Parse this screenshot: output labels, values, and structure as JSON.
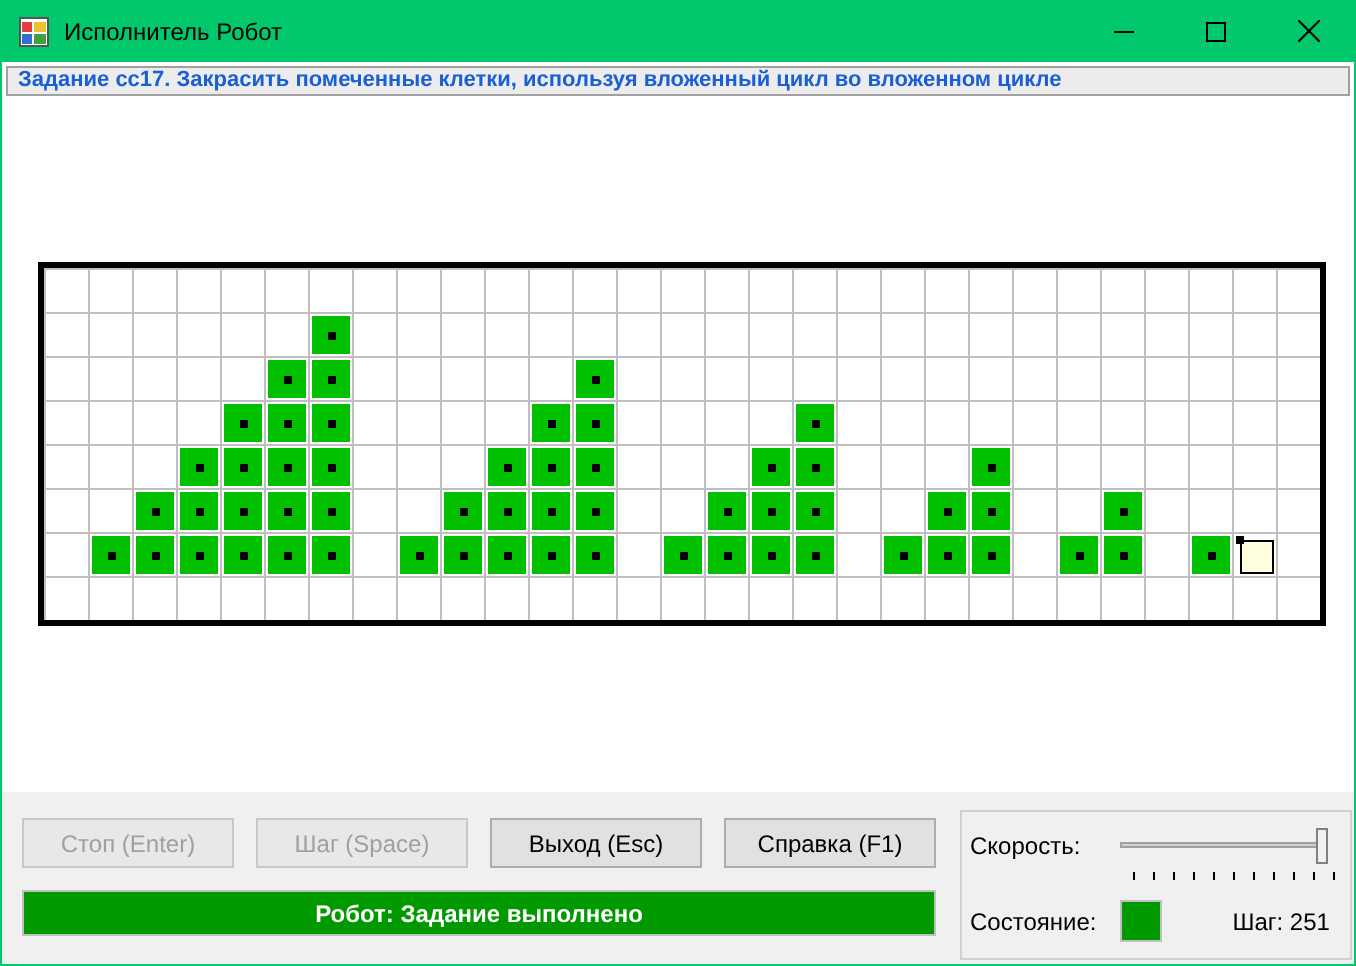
{
  "window": {
    "title": "Исполнитель Робот"
  },
  "task": {
    "text": "Задание cc17. Закрасить помеченные клетки, используя вложенный цикл во вложенном цикле"
  },
  "field": {
    "rows": [
      {
        "cells": [
          {
            "kind": "empty"
          },
          {
            "kind": "empty"
          },
          {
            "kind": "empty"
          },
          {
            "kind": "empty"
          },
          {
            "kind": "empty"
          },
          {
            "kind": "empty"
          },
          {
            "kind": "empty"
          },
          {
            "kind": "empty"
          },
          {
            "kind": "empty"
          },
          {
            "kind": "empty"
          },
          {
            "kind": "empty"
          },
          {
            "kind": "empty"
          },
          {
            "kind": "empty"
          },
          {
            "kind": "empty"
          },
          {
            "kind": "empty"
          },
          {
            "kind": "empty"
          },
          {
            "kind": "empty"
          },
          {
            "kind": "empty"
          },
          {
            "kind": "empty"
          },
          {
            "kind": "empty"
          },
          {
            "kind": "empty"
          },
          {
            "kind": "empty"
          },
          {
            "kind": "empty"
          },
          {
            "kind": "empty"
          },
          {
            "kind": "empty"
          },
          {
            "kind": "empty"
          },
          {
            "kind": "empty"
          },
          {
            "kind": "empty"
          },
          {
            "kind": "empty"
          }
        ]
      },
      {
        "cells": [
          {
            "kind": "empty"
          },
          {
            "kind": "empty"
          },
          {
            "kind": "empty"
          },
          {
            "kind": "empty"
          },
          {
            "kind": "empty"
          },
          {
            "kind": "empty"
          },
          {
            "kind": "painted"
          },
          {
            "kind": "empty"
          },
          {
            "kind": "empty"
          },
          {
            "kind": "empty"
          },
          {
            "kind": "empty"
          },
          {
            "kind": "empty"
          },
          {
            "kind": "empty"
          },
          {
            "kind": "empty"
          },
          {
            "kind": "empty"
          },
          {
            "kind": "empty"
          },
          {
            "kind": "empty"
          },
          {
            "kind": "empty"
          },
          {
            "kind": "empty"
          },
          {
            "kind": "empty"
          },
          {
            "kind": "empty"
          },
          {
            "kind": "empty"
          },
          {
            "kind": "empty"
          },
          {
            "kind": "empty"
          },
          {
            "kind": "empty"
          },
          {
            "kind": "empty"
          },
          {
            "kind": "empty"
          },
          {
            "kind": "empty"
          },
          {
            "kind": "empty"
          }
        ]
      },
      {
        "cells": [
          {
            "kind": "empty"
          },
          {
            "kind": "empty"
          },
          {
            "kind": "empty"
          },
          {
            "kind": "empty"
          },
          {
            "kind": "empty"
          },
          {
            "kind": "painted"
          },
          {
            "kind": "painted"
          },
          {
            "kind": "empty"
          },
          {
            "kind": "empty"
          },
          {
            "kind": "empty"
          },
          {
            "kind": "empty"
          },
          {
            "kind": "empty"
          },
          {
            "kind": "painted"
          },
          {
            "kind": "empty"
          },
          {
            "kind": "empty"
          },
          {
            "kind": "empty"
          },
          {
            "kind": "empty"
          },
          {
            "kind": "empty"
          },
          {
            "kind": "empty"
          },
          {
            "kind": "empty"
          },
          {
            "kind": "empty"
          },
          {
            "kind": "empty"
          },
          {
            "kind": "empty"
          },
          {
            "kind": "empty"
          },
          {
            "kind": "empty"
          },
          {
            "kind": "empty"
          },
          {
            "kind": "empty"
          },
          {
            "kind": "empty"
          },
          {
            "kind": "empty"
          }
        ]
      },
      {
        "cells": [
          {
            "kind": "empty"
          },
          {
            "kind": "empty"
          },
          {
            "kind": "empty"
          },
          {
            "kind": "empty"
          },
          {
            "kind": "painted"
          },
          {
            "kind": "painted"
          },
          {
            "kind": "painted"
          },
          {
            "kind": "empty"
          },
          {
            "kind": "empty"
          },
          {
            "kind": "empty"
          },
          {
            "kind": "empty"
          },
          {
            "kind": "painted"
          },
          {
            "kind": "painted"
          },
          {
            "kind": "empty"
          },
          {
            "kind": "empty"
          },
          {
            "kind": "empty"
          },
          {
            "kind": "empty"
          },
          {
            "kind": "painted"
          },
          {
            "kind": "empty"
          },
          {
            "kind": "empty"
          },
          {
            "kind": "empty"
          },
          {
            "kind": "empty"
          },
          {
            "kind": "empty"
          },
          {
            "kind": "empty"
          },
          {
            "kind": "empty"
          },
          {
            "kind": "empty"
          },
          {
            "kind": "empty"
          },
          {
            "kind": "empty"
          },
          {
            "kind": "empty"
          }
        ]
      },
      {
        "cells": [
          {
            "kind": "empty"
          },
          {
            "kind": "empty"
          },
          {
            "kind": "empty"
          },
          {
            "kind": "painted"
          },
          {
            "kind": "painted"
          },
          {
            "kind": "painted"
          },
          {
            "kind": "painted"
          },
          {
            "kind": "empty"
          },
          {
            "kind": "empty"
          },
          {
            "kind": "empty"
          },
          {
            "kind": "painted"
          },
          {
            "kind": "painted"
          },
          {
            "kind": "painted"
          },
          {
            "kind": "empty"
          },
          {
            "kind": "empty"
          },
          {
            "kind": "empty"
          },
          {
            "kind": "painted"
          },
          {
            "kind": "painted"
          },
          {
            "kind": "empty"
          },
          {
            "kind": "empty"
          },
          {
            "kind": "empty"
          },
          {
            "kind": "painted"
          },
          {
            "kind": "empty"
          },
          {
            "kind": "empty"
          },
          {
            "kind": "empty"
          },
          {
            "kind": "empty"
          },
          {
            "kind": "empty"
          },
          {
            "kind": "empty"
          },
          {
            "kind": "empty"
          }
        ]
      },
      {
        "cells": [
          {
            "kind": "empty"
          },
          {
            "kind": "empty"
          },
          {
            "kind": "painted"
          },
          {
            "kind": "painted"
          },
          {
            "kind": "painted"
          },
          {
            "kind": "painted"
          },
          {
            "kind": "painted"
          },
          {
            "kind": "empty"
          },
          {
            "kind": "empty"
          },
          {
            "kind": "painted"
          },
          {
            "kind": "painted"
          },
          {
            "kind": "painted"
          },
          {
            "kind": "painted"
          },
          {
            "kind": "empty"
          },
          {
            "kind": "empty"
          },
          {
            "kind": "painted"
          },
          {
            "kind": "painted"
          },
          {
            "kind": "painted"
          },
          {
            "kind": "empty"
          },
          {
            "kind": "empty"
          },
          {
            "kind": "painted"
          },
          {
            "kind": "painted"
          },
          {
            "kind": "empty"
          },
          {
            "kind": "empty"
          },
          {
            "kind": "painted"
          },
          {
            "kind": "empty"
          },
          {
            "kind": "empty"
          },
          {
            "kind": "empty"
          },
          {
            "kind": "empty"
          }
        ]
      },
      {
        "cells": [
          {
            "kind": "empty"
          },
          {
            "kind": "painted"
          },
          {
            "kind": "painted"
          },
          {
            "kind": "painted"
          },
          {
            "kind": "painted"
          },
          {
            "kind": "painted"
          },
          {
            "kind": "painted"
          },
          {
            "kind": "empty"
          },
          {
            "kind": "painted"
          },
          {
            "kind": "painted"
          },
          {
            "kind": "painted"
          },
          {
            "kind": "painted"
          },
          {
            "kind": "painted"
          },
          {
            "kind": "empty"
          },
          {
            "kind": "painted"
          },
          {
            "kind": "painted"
          },
          {
            "kind": "painted"
          },
          {
            "kind": "painted"
          },
          {
            "kind": "empty"
          },
          {
            "kind": "painted"
          },
          {
            "kind": "painted"
          },
          {
            "kind": "painted"
          },
          {
            "kind": "empty"
          },
          {
            "kind": "painted"
          },
          {
            "kind": "painted"
          },
          {
            "kind": "empty"
          },
          {
            "kind": "painted"
          },
          {
            "kind": "robot"
          },
          {
            "kind": "empty"
          }
        ]
      },
      {
        "cells": [
          {
            "kind": "empty"
          },
          {
            "kind": "empty"
          },
          {
            "kind": "empty"
          },
          {
            "kind": "empty"
          },
          {
            "kind": "empty"
          },
          {
            "kind": "empty"
          },
          {
            "kind": "empty"
          },
          {
            "kind": "empty"
          },
          {
            "kind": "empty"
          },
          {
            "kind": "empty"
          },
          {
            "kind": "empty"
          },
          {
            "kind": "empty"
          },
          {
            "kind": "empty"
          },
          {
            "kind": "empty"
          },
          {
            "kind": "empty"
          },
          {
            "kind": "empty"
          },
          {
            "kind": "empty"
          },
          {
            "kind": "empty"
          },
          {
            "kind": "empty"
          },
          {
            "kind": "empty"
          },
          {
            "kind": "empty"
          },
          {
            "kind": "empty"
          },
          {
            "kind": "empty"
          },
          {
            "kind": "empty"
          },
          {
            "kind": "empty"
          },
          {
            "kind": "empty"
          },
          {
            "kind": "empty"
          },
          {
            "kind": "empty"
          },
          {
            "kind": "empty"
          }
        ]
      }
    ]
  },
  "buttons": [
    {
      "label": "Стоп (Enter)",
      "disabled": true
    },
    {
      "label": "Шаг (Space)",
      "disabled": true
    },
    {
      "label": "Выход (Esc)",
      "disabled": false
    },
    {
      "label": "Справка (F1)",
      "disabled": false
    }
  ],
  "status": {
    "text": "Робот: Задание выполнено"
  },
  "speed": {
    "label": "Скорость:",
    "level": 1.0
  },
  "state": {
    "label": "Состояние:",
    "color": "#009900"
  },
  "step": {
    "text": "Шаг: 251"
  }
}
